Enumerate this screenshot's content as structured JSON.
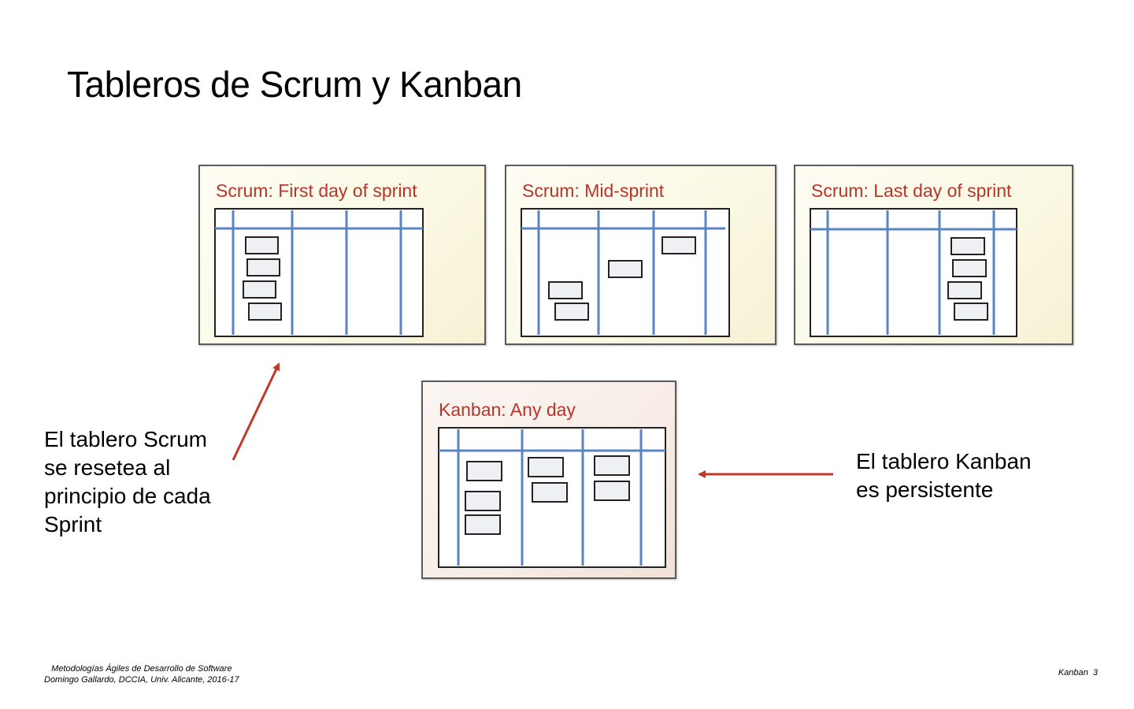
{
  "slide": {
    "title": "Tableros de Scrum y Kanban"
  },
  "boards": {
    "scrum_first": {
      "title": "Scrum: First day of sprint"
    },
    "scrum_mid": {
      "title": "Scrum: Mid-sprint"
    },
    "scrum_last": {
      "title": "Scrum: Last day of sprint"
    },
    "kanban": {
      "title": "Kanban: Any day"
    }
  },
  "notes": {
    "scrum": [
      "El tablero Scrum",
      "se resetea al",
      "principio de cada",
      "Sprint"
    ],
    "kanban": [
      "El tablero Kanban",
      "es persistente"
    ]
  },
  "footer": {
    "course": "Metodologías Ágiles de Desarrollo de Software",
    "author": "Domingo Gallardo, DCCIA, Univ. Alicante, 2016-17",
    "section": "Kanban",
    "page": "3"
  },
  "colors": {
    "title_red": "#b6362b",
    "arrow_red": "#c0392b",
    "column_blue": "#5b84c4",
    "frame_dark": "#222222"
  }
}
